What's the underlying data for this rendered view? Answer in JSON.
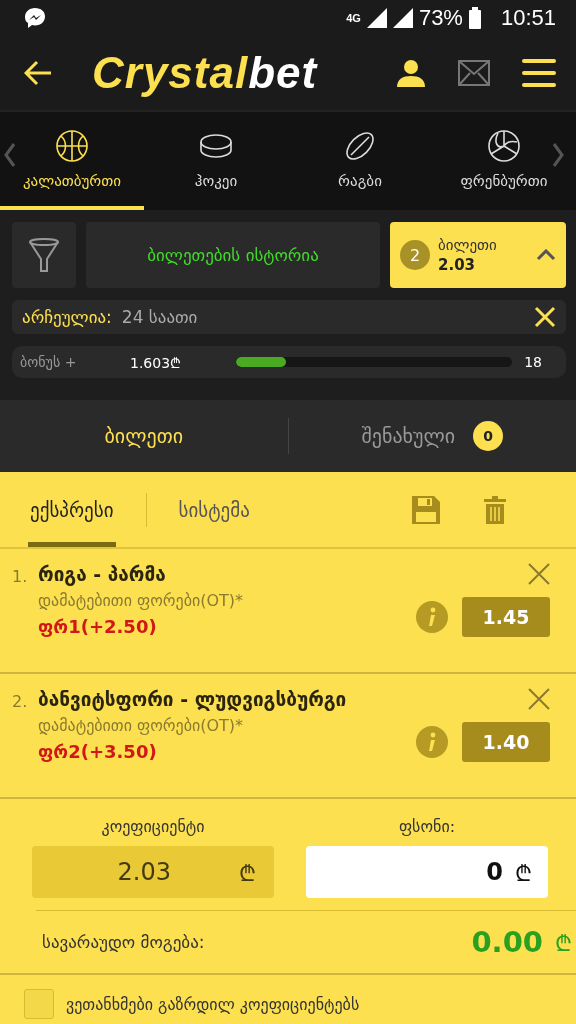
{
  "status_bar": {
    "network": "4G",
    "battery": "73%",
    "time": "10:51"
  },
  "header": {
    "logo": [
      "Crystal",
      "bet"
    ]
  },
  "sports": [
    {
      "label": "კალათბურთი",
      "selected": true,
      "kind": "basketball"
    },
    {
      "label": "ჰოკეი",
      "selected": false,
      "kind": "hockey"
    },
    {
      "label": "რაგბი",
      "selected": false,
      "kind": "rugby"
    },
    {
      "label": "ფრენბურთი",
      "selected": false,
      "kind": "volleyball"
    }
  ],
  "toolbar": {
    "history_button": "ბილეთების ისტორია",
    "ticket": {
      "count": "2",
      "label": "ბილეთი",
      "odds": "2.03"
    }
  },
  "filter": {
    "label": "არჩეულია:",
    "value": "24 საათი"
  },
  "bonus": {
    "label": "ბონუს +",
    "amount": "1.603₾",
    "level": 0.18,
    "count": "18"
  },
  "ticket_tabs": [
    {
      "label": "ბილეთი",
      "selected": true
    },
    {
      "label": "შენახული",
      "selected": false,
      "badge": "0"
    }
  ],
  "bet_types": [
    {
      "label": "ექსპრესი",
      "selected": true
    },
    {
      "label": "სისტემა",
      "selected": false
    }
  ],
  "bets": [
    {
      "number": "1.",
      "match": "რიგა - პარმა",
      "market": "დამატებითი ფორები(OT)*",
      "pick": "ფრ1(+2.50)",
      "odds": "1.45"
    },
    {
      "number": "2.",
      "match": "ბანვიტსფორი - ლუდვიგსბურგი",
      "market": "დამატებითი ფორები(OT)*",
      "pick": "ფრ2(+3.50)",
      "odds": "1.40"
    }
  ],
  "stake": {
    "odds_label": "კოეფიციენტი",
    "odds_value": "2.03",
    "odds_currency": "₾",
    "stake_label": "ფსონი:",
    "stake_value": "0",
    "stake_currency": "₾",
    "win_label": "სავარაუდო მოგება:",
    "win_value": "0.00",
    "win_currency": "₾"
  },
  "agreement": {
    "label": "ვეთანხმები გაზრდილ კოეფიციენტებს",
    "checked": false
  }
}
